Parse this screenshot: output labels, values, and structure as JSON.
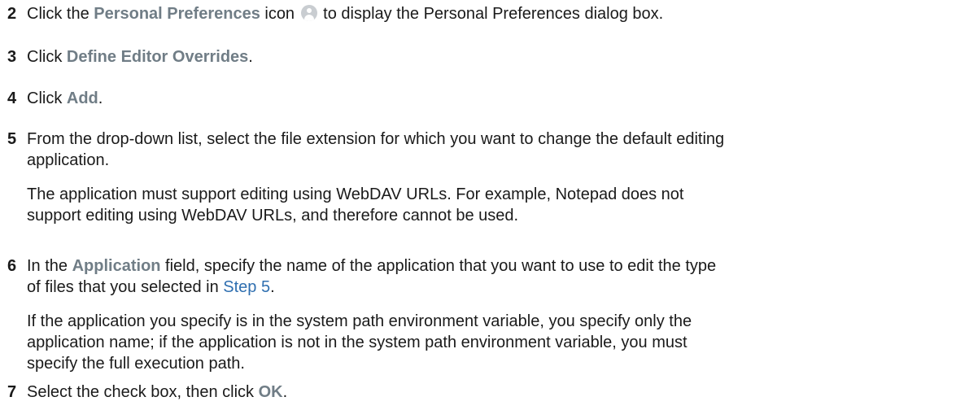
{
  "steps": [
    {
      "num": "2",
      "t1": "Click the ",
      "ui1": "Personal Preferences",
      "t2": " icon ",
      "icon": "personal-preferences-icon",
      "t3": " to display the Personal Preferences dialog box."
    },
    {
      "num": "3",
      "t1": "Click ",
      "ui1": "Define Editor Overrides",
      "t2": "."
    },
    {
      "num": "4",
      "t1": "Click ",
      "ui1": "Add",
      "t2": "."
    },
    {
      "num": "5",
      "line1": "From the drop-down list, select the file extension for which you want to change the default editing",
      "line2": "application.",
      "note_line1": "The application must support editing using WebDAV URLs. For example, Notepad does not",
      "note_line2": "support editing using WebDAV URLs, and therefore cannot be used."
    },
    {
      "num": "6",
      "t1": "In the ",
      "ui1": "Application",
      "t2": " field, specify the name of the application that you want to use to edit the type",
      "line2_pre": "of files that you selected in ",
      "link": "Step 5",
      "line2_post": ".",
      "note_line1": "If the application you specify is in the system path environment variable, you specify only the",
      "note_line2": "application name; if the application is not in the system path environment variable, you must",
      "note_line3": "specify the full execution path."
    },
    {
      "num": "7",
      "t1": "Select the check box, then click ",
      "ui1": "OK",
      "t2": "."
    }
  ]
}
